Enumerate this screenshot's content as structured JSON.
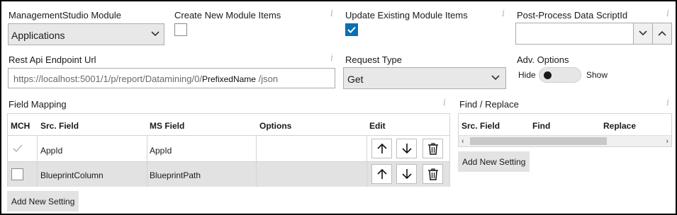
{
  "module_field": {
    "label": "ManagementStudio Module",
    "value": "Applications"
  },
  "create_new": {
    "label": "Create New Module Items",
    "checked": false
  },
  "update_existing": {
    "label": "Update Existing Module Items",
    "checked": true
  },
  "post_process": {
    "label": "Post-Process Data ScriptId",
    "value": ""
  },
  "rest_api": {
    "label": "Rest Api Endpoint Url",
    "url_prefix": "https://localhost:5001/1/p/report/Datamining/0/",
    "url_placeholder": "PrefixedName",
    "url_suffix": "/json"
  },
  "request_type": {
    "label": "Request Type",
    "value": "Get"
  },
  "adv_options": {
    "label": "Adv. Options",
    "off_label": "Hide",
    "on_label": "Show",
    "state": "Hide"
  },
  "field_mapping": {
    "label": "Field Mapping",
    "columns": [
      "MCH",
      "Src. Field",
      "MS Field",
      "Options",
      "Edit"
    ],
    "rows": [
      {
        "mch": true,
        "mch_disabled": true,
        "src": "AppId",
        "ms": "AppId",
        "options": ""
      },
      {
        "mch": false,
        "mch_disabled": false,
        "src": "BlueprintColumn",
        "ms": "BlueprintPath",
        "options": ""
      }
    ],
    "add_button": "Add New Setting"
  },
  "find_replace": {
    "label": "Find / Replace",
    "columns": [
      "Src. Field",
      "Find",
      "Replace"
    ],
    "add_button": "Add New Setting"
  },
  "icons": {
    "info": "info-icon",
    "dropdown": "chevron-down-icon",
    "up": "arrow-up-icon",
    "down": "arrow-down-icon",
    "delete": "trash-icon"
  },
  "colors": {
    "accent": "#0a6fb5",
    "button_bg": "#e3e3e3",
    "row_alt": "#e2e2e2"
  }
}
